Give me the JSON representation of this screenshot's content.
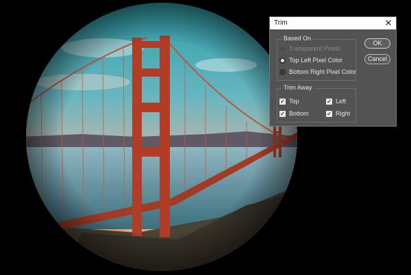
{
  "dialog": {
    "title": "Trim",
    "close_glyph": "✕",
    "based_on": {
      "legend": "Based On",
      "options": [
        {
          "label": "Transparent Pixels",
          "selected": false,
          "enabled": false
        },
        {
          "label": "Top Left Pixel Color",
          "selected": true,
          "enabled": true
        },
        {
          "label": "Bottom Right Pixel Color",
          "selected": false,
          "enabled": true
        }
      ]
    },
    "trim_away": {
      "legend": "Trim Away",
      "options": [
        {
          "label": "Top",
          "checked": true
        },
        {
          "label": "Left",
          "checked": true
        },
        {
          "label": "Bottom",
          "checked": true
        },
        {
          "label": "Right",
          "checked": true
        }
      ]
    },
    "buttons": {
      "ok": "OK",
      "cancel": "Cancel"
    },
    "check_glyph": "✓"
  },
  "colors": {
    "background": "#000000",
    "dialog_bg": "#535353",
    "sky_top": "#2f9fa8",
    "sky_bottom": "#f0a47e",
    "bridge": "#b2402a",
    "water": "#5c8f9c"
  }
}
